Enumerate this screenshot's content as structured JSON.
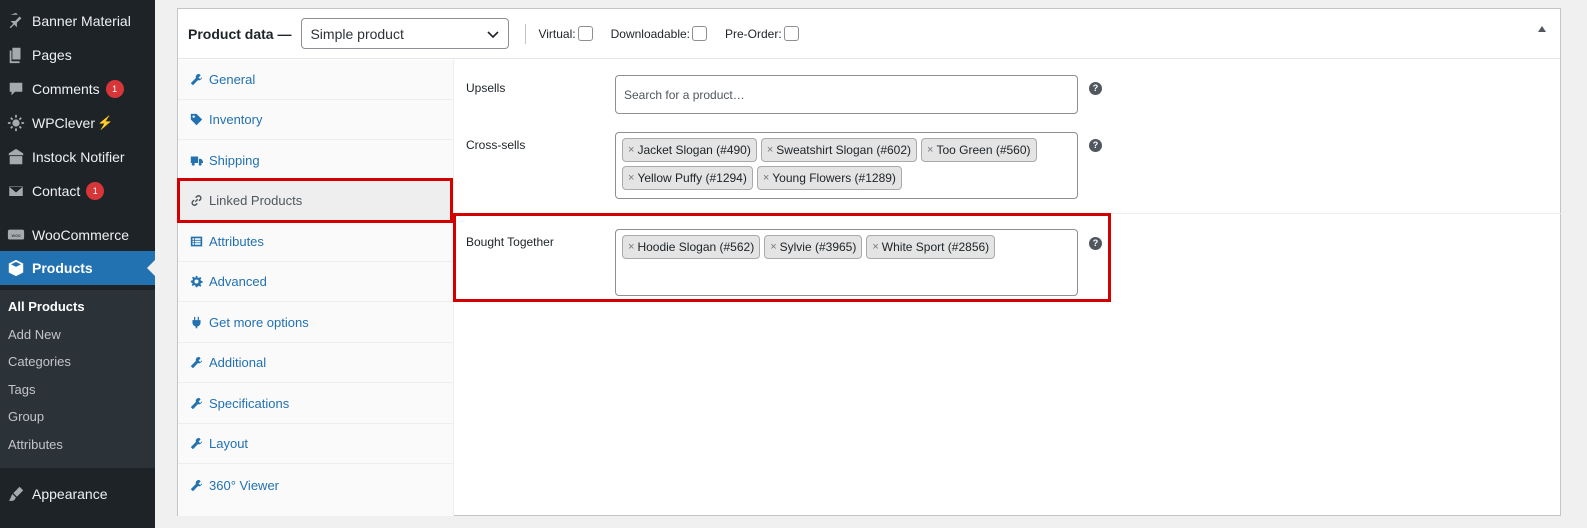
{
  "sidebar": {
    "items": [
      {
        "label": "Banner Material",
        "icon": "pin-icon"
      },
      {
        "label": "Pages",
        "icon": "pages-icon"
      },
      {
        "label": "Comments",
        "icon": "comment-icon",
        "badge": "1"
      },
      {
        "label": "WPClever",
        "icon": "sun-icon",
        "suffix": "⚡"
      },
      {
        "label": "Instock Notifier",
        "icon": "store-icon"
      },
      {
        "label": "Contact",
        "icon": "mail-icon",
        "badge": "1"
      },
      {
        "label": "WooCommerce",
        "icon": "woo-icon"
      },
      {
        "label": "Products",
        "icon": "box-icon",
        "active": true
      },
      {
        "label": "Appearance",
        "icon": "brush-icon"
      }
    ],
    "submenu": [
      "All Products",
      "Add New",
      "Categories",
      "Tags",
      "Group",
      "Attributes"
    ],
    "submenu_current": "All Products"
  },
  "product_data": {
    "title": "Product data —",
    "type_selected": "Simple product",
    "options": [
      {
        "label": "Virtual:",
        "checked": false
      },
      {
        "label": "Downloadable:",
        "checked": false
      },
      {
        "label": "Pre-Order:",
        "checked": false
      }
    ],
    "tabs": [
      {
        "label": "General",
        "icon": "wrench-icon"
      },
      {
        "label": "Inventory",
        "icon": "tag-icon"
      },
      {
        "label": "Shipping",
        "icon": "truck-icon"
      },
      {
        "label": "Linked Products",
        "icon": "link-icon",
        "active": true
      },
      {
        "label": "Attributes",
        "icon": "list-icon"
      },
      {
        "label": "Advanced",
        "icon": "gear-icon"
      },
      {
        "label": "Get more options",
        "icon": "plug-icon"
      },
      {
        "label": "Additional",
        "icon": "wrench-icon"
      },
      {
        "label": "Specifications",
        "icon": "wrench-icon"
      },
      {
        "label": "Layout",
        "icon": "wrench-icon"
      },
      {
        "label": "360° Viewer",
        "icon": "wrench-icon"
      }
    ],
    "linked": {
      "upsells": {
        "label": "Upsells",
        "placeholder": "Search for a product…"
      },
      "cross_sells": {
        "label": "Cross-sells",
        "tokens": [
          "Jacket Slogan (#490)",
          "Sweatshirt Slogan (#602)",
          "Too Green (#560)",
          "Yellow Puffy (#1294)",
          "Young Flowers (#1289)"
        ]
      },
      "bought_together": {
        "label": "Bought Together",
        "tokens": [
          "Hoodie Slogan (#562)",
          "Sylvie (#3965)",
          "White Sport (#2856)"
        ]
      },
      "help_glyph": "?",
      "remove_glyph": "×"
    }
  },
  "colors": {
    "sidebar_bg": "#1d2327",
    "active_blue": "#2271b1",
    "highlight_red": "#d40000",
    "badge_red": "#d63638"
  }
}
